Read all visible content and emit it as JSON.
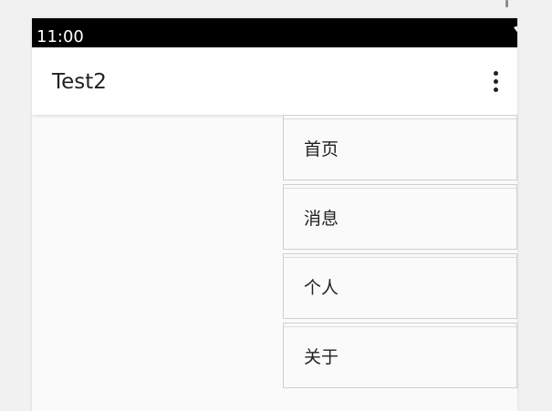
{
  "status_bar": {
    "time": "11:00",
    "icons": [
      "wifi-icon",
      "battery-icon"
    ]
  },
  "app_bar": {
    "title": "Test2",
    "overflow_icon": "more-vert-icon"
  },
  "menu": {
    "items": [
      {
        "label": "首页"
      },
      {
        "label": "消息"
      },
      {
        "label": "个人"
      },
      {
        "label": "关于"
      }
    ]
  },
  "colors": {
    "status_bar_bg": "#000000",
    "app_bar_bg": "#ffffff",
    "content_bg": "#fafafa",
    "menu_border": "#cfcfcf"
  }
}
